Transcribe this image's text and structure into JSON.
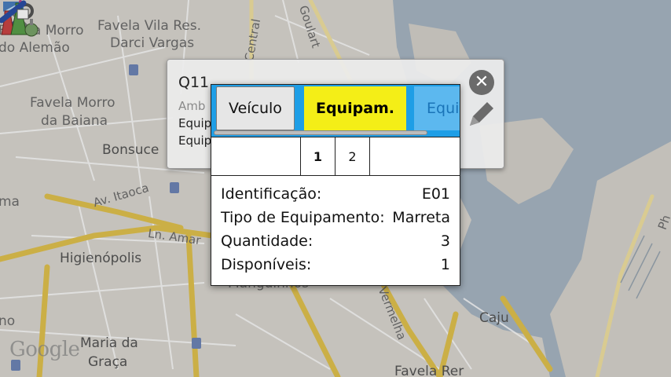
{
  "map": {
    "labels": {
      "favela_morro_alemao_1": "Favela Morro",
      "favela_morro_alemao_2": "do Alemão",
      "favela_vila_res_1": "Favela Vila Res.",
      "favela_vila_res_2": "Darci Vargas",
      "central": "Central",
      "goulart": "Goulart",
      "favela_morro_baiana_1": "Favela Morro",
      "favela_morro_baiana_2": "da Baiana",
      "bonsucesso": "Bonsuce",
      "av_itaoca": "Av. Itaoca",
      "ln_amarela": "Ln. Amar",
      "higienopolis": "Higienópolis",
      "manguinhos": "Manguinhos",
      "vermelha": "Vermelha",
      "caju": "Caju",
      "maria_graca_1": "Maria da",
      "maria_graca_2": "Graça",
      "favela_rer": "Favela Rer",
      "ma": "ma",
      "no": "no",
      "ph": "Ph"
    },
    "google_logo": "Google"
  },
  "balloon": {
    "title": "Q11",
    "line1": "Amb",
    "line2": "Equip",
    "line3": "Equip",
    "close_glyph": "✕"
  },
  "dialog": {
    "tabs": {
      "vehicle": "Veículo",
      "equipment": "Equipam.",
      "equipment_next": "Equi"
    },
    "pager": {
      "page1": "1",
      "page2": "2"
    },
    "fields": [
      {
        "label": "Identificação:",
        "value": "E01"
      },
      {
        "label": "Tipo de Equipamento:",
        "value": "Marreta"
      },
      {
        "label": "Quantidade:",
        "value": "3"
      },
      {
        "label": "Disponíveis:",
        "value": "1"
      }
    ]
  },
  "colors": {
    "tab_bar": "#1e9ee6",
    "active_tab": "#f4ee17",
    "map_bg": "#d9d6cf",
    "road_yellow": "#e8c84a",
    "water": "#a6b6c6"
  }
}
